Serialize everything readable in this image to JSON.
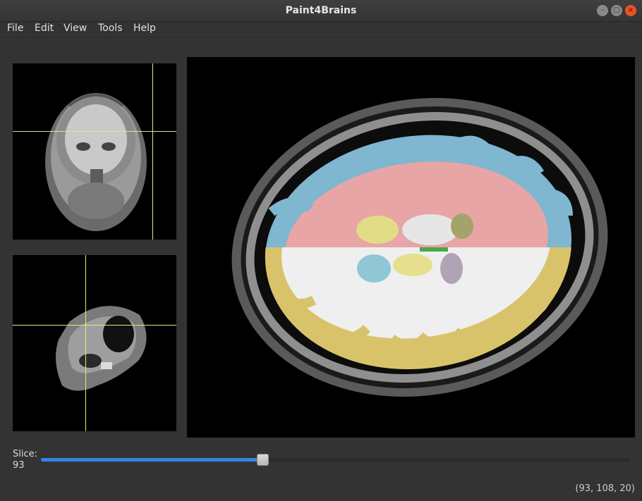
{
  "window": {
    "title": "Paint4Brains",
    "buttons": {
      "minimize": "–",
      "maximize": "□",
      "close": "×"
    }
  },
  "menu": [
    "File",
    "Edit",
    "View",
    "Tools",
    "Help"
  ],
  "slider": {
    "label": "Slice:",
    "value": "93",
    "fraction": 0.376
  },
  "status": {
    "coordinates": "(93, 108, 20)"
  },
  "overlay_colors": {
    "cortex_left": "#7fb6d0",
    "white_matter_left": "#e8a5a5",
    "cortex_right": "#d9c36a",
    "white_matter_right": "#efefef",
    "crosshair": "#e6e680"
  }
}
